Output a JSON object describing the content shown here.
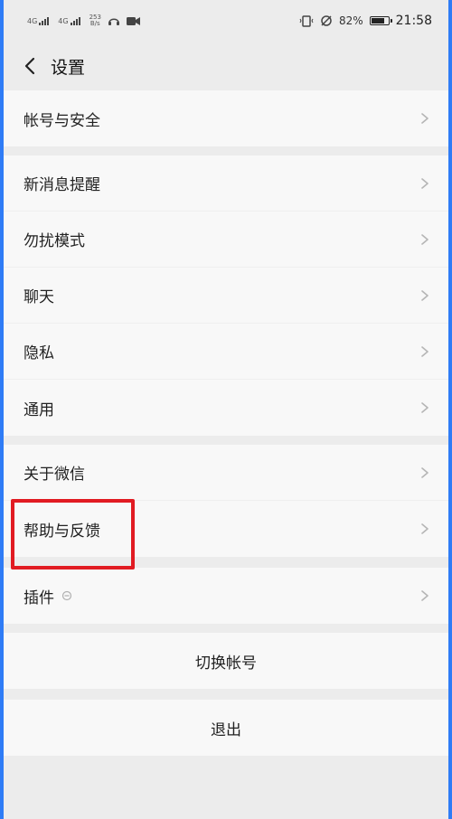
{
  "status_bar": {
    "signal_1": "4G",
    "signal_2": "4G",
    "speed_value": "253",
    "speed_unit": "B/s",
    "battery": "82%",
    "time": "21:58"
  },
  "header": {
    "title": "设置"
  },
  "sections": {
    "account": [
      {
        "label": "帐号与安全"
      }
    ],
    "general": [
      {
        "label": "新消息提醒"
      },
      {
        "label": "勿扰模式"
      },
      {
        "label": "聊天"
      },
      {
        "label": "隐私"
      },
      {
        "label": "通用"
      }
    ],
    "about": [
      {
        "label": "关于微信"
      },
      {
        "label": "帮助与反馈"
      }
    ],
    "plugins": [
      {
        "label": "插件"
      }
    ]
  },
  "actions": {
    "switch_account": "切换帐号",
    "logout": "退出"
  },
  "colors": {
    "highlight": "#e11b22",
    "frame": "#2f7cf6"
  }
}
